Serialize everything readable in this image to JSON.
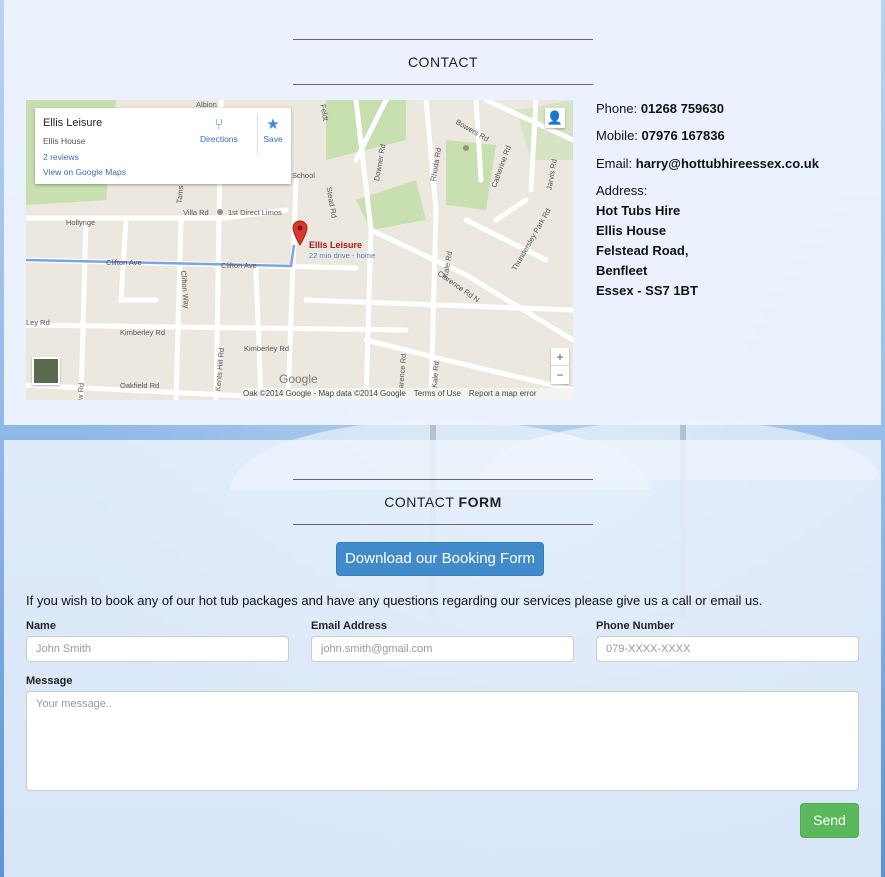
{
  "contact": {
    "title": "CONTACT",
    "phone_label": "Phone:",
    "phone": "01268 759630",
    "mobile_label": "Mobile:",
    "mobile": "07976 167836",
    "email_label": "Email:",
    "email": "harry@hottubhireessex.co.uk",
    "address_label": "Address:",
    "address_lines": [
      "Hot Tubs Hire",
      "Ellis House",
      "Felstead Road,",
      "Benfleet",
      "Essex - SS7 1BT"
    ]
  },
  "map": {
    "place_name": "Ellis Leisure",
    "place_sub": "Ellis House",
    "reviews": "2 reviews",
    "view_link": "View on Google Maps",
    "directions": "Directions",
    "save": "Save",
    "pin_label": "Ellis Leisure",
    "pin_sub": "22 min drive - home",
    "zoom_in": "+",
    "zoom_out": "−",
    "logo": "Google",
    "footer": [
      "Oak",
      "©2014 Google - Map data ©2014 Google",
      "Terms of Use",
      "Report a map error"
    ],
    "street_labels": [
      "Albion",
      "Feldt",
      "Bowers Rd",
      "School",
      "Downer Rd",
      "Rhoda Rd",
      "Catherine Rd",
      "Jarvis Rd",
      "Villa Rd",
      "1st Direct Limos",
      "Hollynge",
      "Stead Rd",
      "Clifton Ave",
      "Clifton Ave",
      "Clifton Way",
      "Kale Rd",
      "Thundersley Park Rd",
      "Clarence Rd N",
      "Kimberley Rd",
      "Kimberley Rd",
      "Ley Rd",
      "Oakfield Rd",
      "Kents Hill Rd",
      "Clarence Rd",
      "Kale Rd",
      "Tams",
      "ew Rd"
    ],
    "colors": {
      "land": "#ece8df",
      "road": "#ffffff",
      "park": "#c8dfb0",
      "route": "#7ba4e6",
      "pin": "#d9392c"
    }
  },
  "form": {
    "title_light": "CONTACT",
    "title_bold": "FORM",
    "download_button": "Download our Booking Form",
    "intro": "If you wish to book any of our hot tub packages and have any questions regarding our services please give us a call or email us.",
    "name_label": "Name",
    "name_placeholder": "John Smith",
    "email_label": "Email Address",
    "email_placeholder": "john.smith@gmail.com",
    "phone_label": "Phone Number",
    "phone_placeholder": "079-XXXX-XXXX",
    "message_label": "Message",
    "message_placeholder": "Your message..",
    "send_button": "Send",
    "colors": {
      "primary": "#428bca",
      "success": "#5cb85c"
    }
  }
}
